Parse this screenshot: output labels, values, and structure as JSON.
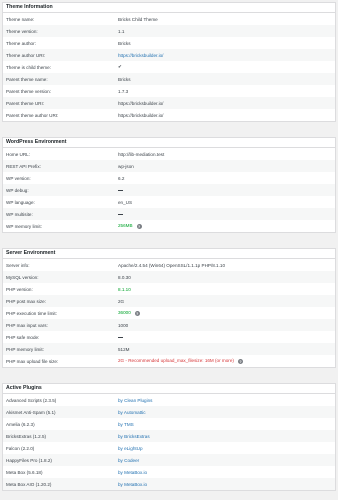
{
  "theme": {
    "title": "Theme Information",
    "rows": [
      {
        "label": "Theme name:",
        "value": "Bricks Child Theme"
      },
      {
        "label": "Theme version:",
        "value": "1.1"
      },
      {
        "label": "Theme author:",
        "value": "Bricks"
      },
      {
        "label": "Theme author URI:",
        "value": "https://bricksbuilder.io/"
      },
      {
        "label": "Theme is child theme:",
        "value": "✔"
      },
      {
        "label": "Parent theme name:",
        "value": "Bricks"
      },
      {
        "label": "Parent theme version:",
        "value": "1.7.3"
      },
      {
        "label": "Parent theme URI:",
        "value": "https://bricksbuilder.io/"
      },
      {
        "label": "Parent theme author URI:",
        "value": "https://bricksbuilder.io/"
      }
    ]
  },
  "wp": {
    "title": "WordPress Environment",
    "rows": [
      {
        "label": "Home URL:",
        "value": "http://lib-mediation.test"
      },
      {
        "label": "REST API Prefix:",
        "value": "wp-json"
      },
      {
        "label": "WP version:",
        "value": "6.2"
      },
      {
        "label": "WP debug:",
        "value": "—"
      },
      {
        "label": "WP language:",
        "value": "en_US"
      },
      {
        "label": "WP multisite:",
        "value": "—"
      },
      {
        "label": "WP memory limit:",
        "value": "256MB"
      }
    ]
  },
  "server": {
    "title": "Server Environment",
    "rows": [
      {
        "label": "Server info:",
        "value": "Apache/2.4.54 (Win64) OpenSSL/1.1.1p PHP/8.1.10"
      },
      {
        "label": "MySQL version:",
        "value": "8.0.30"
      },
      {
        "label": "PHP version:",
        "value": "8.1.10"
      },
      {
        "label": "PHP post max size:",
        "value": "2G"
      },
      {
        "label": "PHP execution time limit:",
        "value": "36000"
      },
      {
        "label": "PHP max input vars:",
        "value": "1000"
      },
      {
        "label": "PHP safe mode:",
        "value": "—"
      },
      {
        "label": "PHP memory limit:",
        "value": "512M"
      },
      {
        "label": "PHP max upload file size:",
        "value": "2G - Recommended upload_max_filesize: 16M (or more)"
      }
    ]
  },
  "plugins": {
    "title": "Active Plugins",
    "rows": [
      {
        "label": "Advanced Scripts (2.3.5)",
        "value": "by Clean Plugins"
      },
      {
        "label": "Akismet Anti-Spam (5.1)",
        "value": "by Automattic"
      },
      {
        "label": "Amelia (6.2.3)",
        "value": "by TMS"
      },
      {
        "label": "BricksExtras (1.2.5)",
        "value": "by BricksExtras"
      },
      {
        "label": "Falcon (2.2.0)",
        "value": "by eLightUp"
      },
      {
        "label": "HappyFiles Pro (1.8.2)",
        "value": "by Codeer"
      },
      {
        "label": "Meta Box (5.6.18)",
        "value": "by MetaBox.io"
      },
      {
        "label": "Meta Box AIO (1.20.2)",
        "value": "by MetaBox.io"
      }
    ]
  },
  "colors": {
    "link": "#2271b1",
    "ok": "#00a32a",
    "error": "#d63638",
    "header_bg": "#ffffff",
    "alt_row": "#f6f7f7"
  },
  "icons": {
    "check": "checkmark-icon",
    "help": "help-circle-icon",
    "dash": "dash-icon"
  }
}
